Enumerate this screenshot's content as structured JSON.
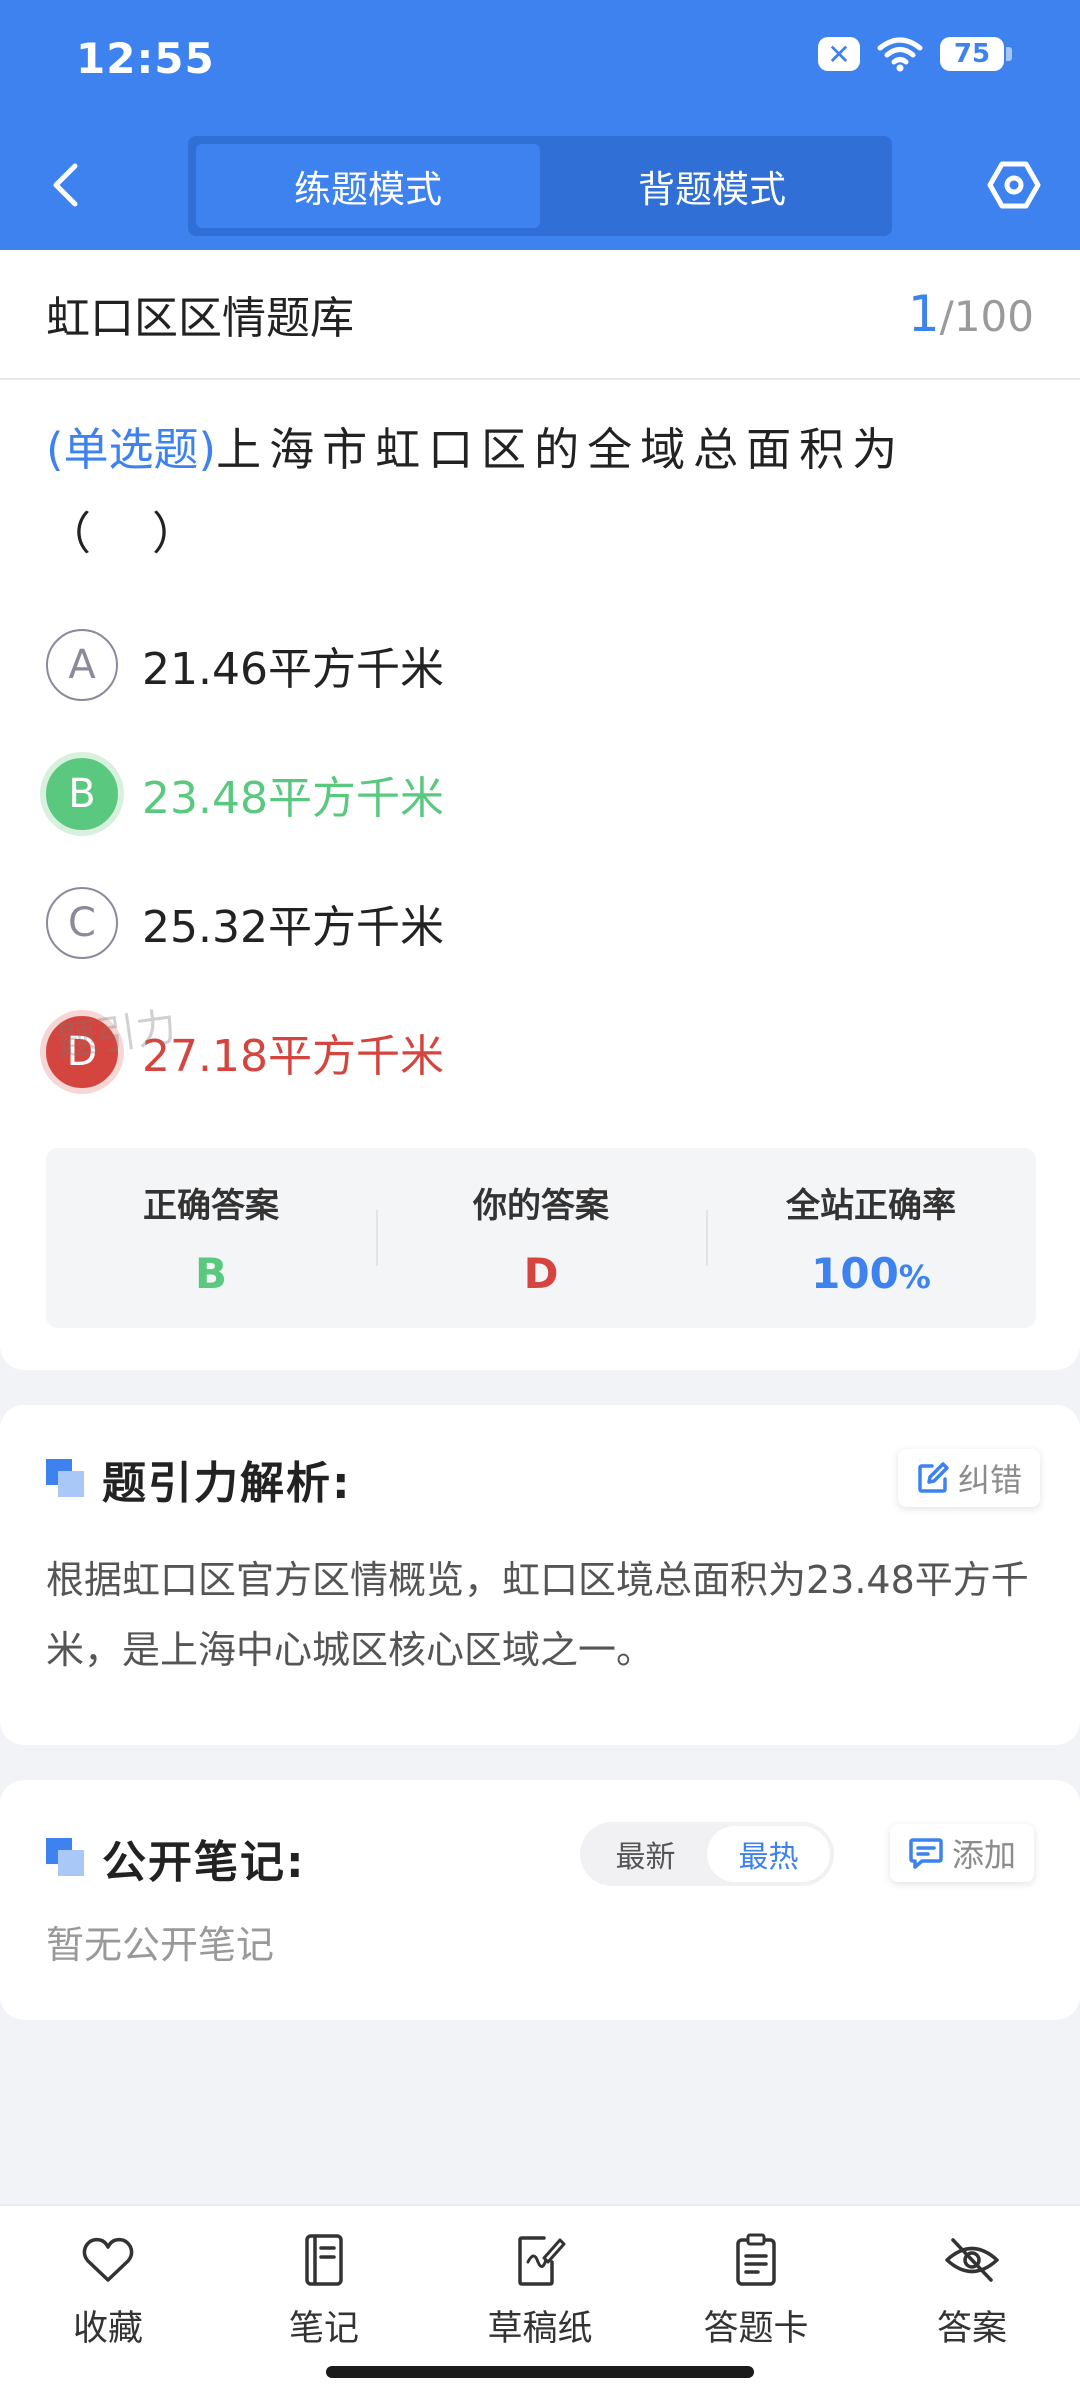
{
  "status_bar": {
    "time": "12:55",
    "battery": "75",
    "sim_icon": "sim-off-icon"
  },
  "header": {
    "modes": [
      {
        "label": "练题模式",
        "active": true
      },
      {
        "label": "背题模式",
        "active": false
      }
    ]
  },
  "question_bank": {
    "title": "虹口区区情题库",
    "current": "1",
    "total": "/100"
  },
  "question": {
    "type": "(单选题)",
    "text": "上海市虹口区的全域总面积为（　）",
    "options": [
      {
        "letter": "A",
        "text": "21.46平方千米",
        "state": "normal"
      },
      {
        "letter": "B",
        "text": "23.48平方千米",
        "state": "correct"
      },
      {
        "letter": "C",
        "text": "25.32平方千米",
        "state": "normal"
      },
      {
        "letter": "D",
        "text": "27.18平方千米",
        "state": "wrong"
      }
    ]
  },
  "result": {
    "correct_label": "正确答案",
    "correct_value": "B",
    "your_label": "你的答案",
    "your_value": "D",
    "rate_label": "全站正确率",
    "rate_value": "100",
    "rate_unit": "%",
    "watermark": "题引力"
  },
  "analysis": {
    "title": "题引力解析:",
    "report_label": "纠错",
    "text": "根据虹口区官方区情概览，虹口区境总面积为23.48平方千米，是上海中心城区核心区域之一。"
  },
  "notes": {
    "title": "公开笔记:",
    "sort_newest": "最新",
    "sort_hottest": "最热",
    "add_label": "添加",
    "empty_text": "暂无公开笔记"
  },
  "bottom_nav": [
    {
      "label": "收藏",
      "icon": "heart-icon"
    },
    {
      "label": "笔记",
      "icon": "notebook-icon"
    },
    {
      "label": "草稿纸",
      "icon": "draft-paper-icon"
    },
    {
      "label": "答题卡",
      "icon": "answer-sheet-icon"
    },
    {
      "label": "答案",
      "icon": "eye-hidden-icon"
    }
  ],
  "colors": {
    "primary": "#3d82ef",
    "correct": "#5ac87e",
    "wrong": "#d5453f"
  }
}
